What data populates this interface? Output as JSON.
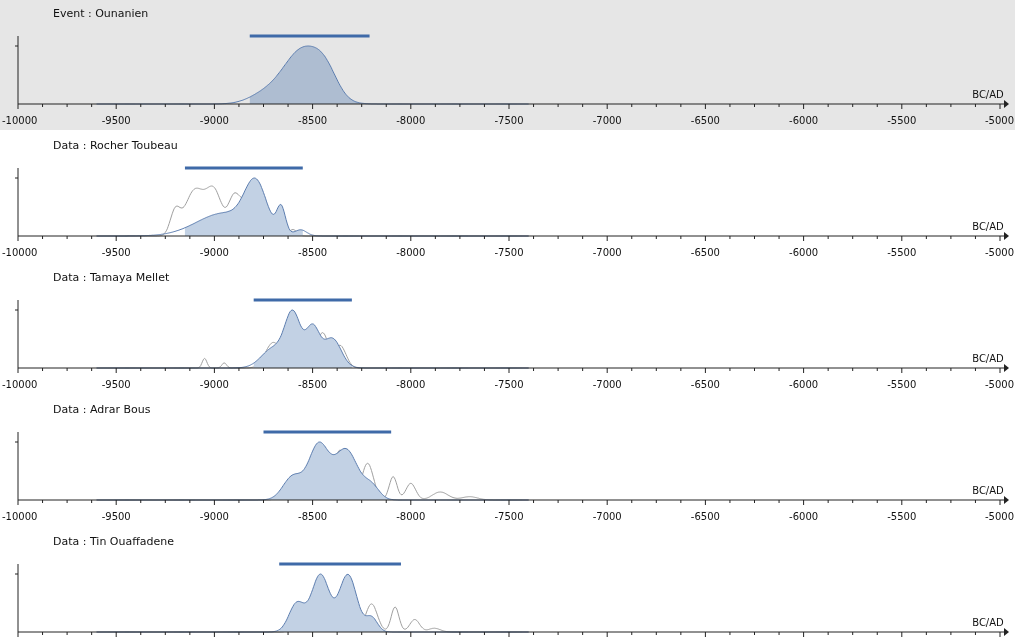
{
  "panels": [
    {
      "label": "Event : Ounanien",
      "selected": true,
      "axis_ticks": [
        "-10000",
        "-9500",
        "-9000",
        "-8500",
        "-8000",
        "-7500",
        "-7000",
        "-6500",
        "-6000",
        "-5500",
        "-5000"
      ],
      "axis_unit": "BC/AD"
    },
    {
      "label": "Data : Rocher Toubeau",
      "selected": false,
      "axis_ticks": [
        "-10000",
        "-9500",
        "-9000",
        "-8500",
        "-8000",
        "-7500",
        "-7000",
        "-6500",
        "-6000",
        "-5500",
        "-5000"
      ],
      "axis_unit": "BC/AD"
    },
    {
      "label": "Data : Tamaya Mellet",
      "selected": false,
      "axis_ticks": [
        "-10000",
        "-9500",
        "-9000",
        "-8500",
        "-8000",
        "-7500",
        "-7000",
        "-6500",
        "-6000",
        "-5500",
        "-5000"
      ],
      "axis_unit": "BC/AD"
    },
    {
      "label": "Data : Adrar Bous",
      "selected": false,
      "axis_ticks": [
        "-10000",
        "-9500",
        "-9000",
        "-8500",
        "-8000",
        "-7500",
        "-7000",
        "-6500",
        "-6000",
        "-5500",
        "-5000"
      ],
      "axis_unit": "BC/AD"
    },
    {
      "label": "Data : Tin Ouaffadene",
      "selected": false,
      "axis_unit": "BC/AD"
    }
  ]
}
